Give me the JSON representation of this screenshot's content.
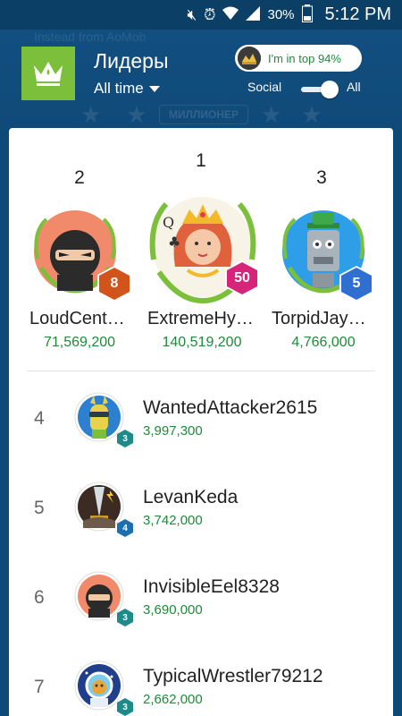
{
  "status_bar": {
    "battery": "30%",
    "time": "5:12 PM"
  },
  "header": {
    "title": "Лидеры",
    "period": "All time",
    "top_badge": "I'm in top 94%",
    "social_label": "Social",
    "all_label": "All",
    "watermark_text": "Instead from AoMob",
    "banner_text": "МИЛЛИОНЕР"
  },
  "podium": [
    {
      "rank": "2",
      "name": "LoudCent…",
      "score": "71,569,200",
      "level": "8",
      "badge_color": "#d2541a",
      "avatar_bg": "#f08a6a",
      "avatar": "ninja-avatar"
    },
    {
      "rank": "1",
      "name": "ExtremeHy…",
      "score": "140,519,200",
      "level": "50",
      "badge_color": "#d6247a",
      "avatar_bg": "#f7f3e6",
      "avatar": "queen-avatar"
    },
    {
      "rank": "3",
      "name": "TorpidJay…",
      "score": "4,766,000",
      "level": "5",
      "badge_color": "#2f6fd2",
      "avatar_bg": "#2f9ee8",
      "avatar": "robot-avatar"
    }
  ],
  "leaders": [
    {
      "rank": "4",
      "name": "WantedAttacker2615",
      "score": "3,997,300",
      "level": "3",
      "avatar": "llama-avatar"
    },
    {
      "rank": "5",
      "name": "LevanKeda",
      "score": "3,742,000",
      "level": "4",
      "avatar": "sword-avatar"
    },
    {
      "rank": "6",
      "name": "InvisibleEel8328",
      "score": "3,690,000",
      "level": "3",
      "avatar": "ninja-avatar"
    },
    {
      "rank": "7",
      "name": "TypicalWrestler79212",
      "score": "2,662,000",
      "level": "3",
      "avatar": "astronaut-avatar"
    }
  ]
}
